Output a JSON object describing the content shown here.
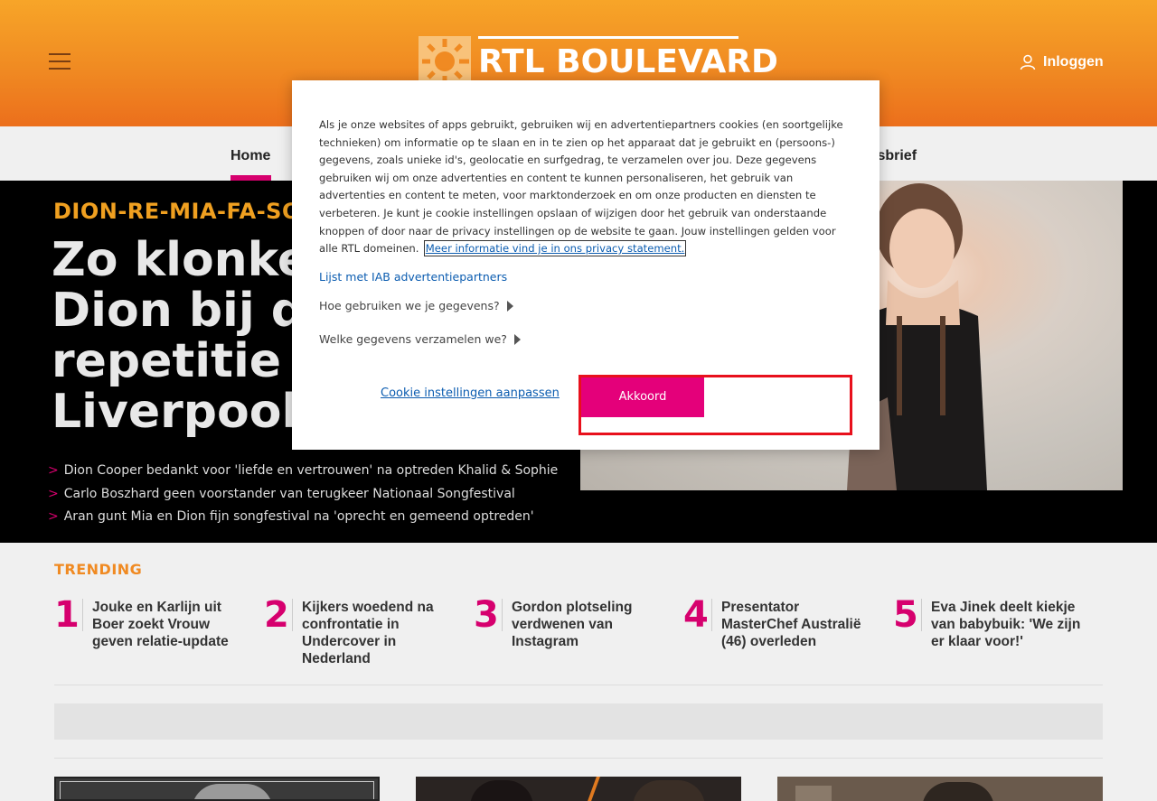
{
  "header": {
    "logo_text": "RTL BOULEVARD",
    "login_label": "Inloggen"
  },
  "nav": {
    "items": [
      {
        "label": "Home",
        "active": true
      },
      {
        "label": "Nieuwsbrief",
        "active": false
      }
    ],
    "partial_visible": "wsbrief"
  },
  "hero": {
    "kicker": "DION-RE-MIA-FA-SOL",
    "title": "Zo klonken Mia en Dion bij de eerste repetitie in Liverpool",
    "visible_title_lines": [
      "Zo klonke",
      "Dion bij de",
      "repetitie i",
      "Liverpool"
    ],
    "related": [
      "Dion Cooper bedankt voor 'liefde en vertrouwen' na optreden Khalid & Sophie",
      "Carlo Boszhard geen voorstander van terugkeer Nationaal Songfestival",
      "Aran gunt Mia en Dion fijn songfestival na 'oprecht en gemeend optreden'"
    ]
  },
  "trending": {
    "heading": "TRENDING",
    "items": [
      {
        "num": "1",
        "text": "Jouke en Karlijn uit Boer zoekt Vrouw geven relatie-update"
      },
      {
        "num": "2",
        "text": "Kijkers woedend na confrontatie in Undercover in Nederland"
      },
      {
        "num": "3",
        "text": "Gordon plotseling verdwenen van Instagram"
      },
      {
        "num": "4",
        "text": "Presentator MasterChef Australië (46) overleden"
      },
      {
        "num": "5",
        "text": "Eva Jinek deelt kiekje van babybuik: 'We zijn er klaar voor!'"
      }
    ]
  },
  "consent": {
    "body": "Als je onze websites of apps gebruikt, gebruiken wij en advertentiepartners cookies (en soortgelijke technieken) om informatie op te slaan en in te zien op het apparaat dat je gebruikt en (persoons-) gegevens, zoals unieke id's, geolocatie en surfgedrag, te verzamelen over jou. Deze gegevens gebruiken wij om onze advertenties en content te kunnen personaliseren, het gebruik van advertenties en content te meten, voor marktonderzoek en om onze producten en diensten te verbeteren. Je kunt je cookie instellingen opslaan of wijzigen door het gebruik van onderstaande knoppen of door naar de privacy instellingen op de website te gaan. Jouw instellingen gelden voor alle RTL domeinen.",
    "privacy_link": "Meer informatie vind je in ons privacy statement.",
    "iab_link": "Lijst met IAB advertentiepartners",
    "accordion_1": "Hoe gebruiken we je gegevens?",
    "accordion_2": "Welke gegevens verzamelen we?",
    "settings_link": "Cookie instellingen aanpassen",
    "accept_label": "Akkoord"
  },
  "colors": {
    "brand_orange": "#f08a22",
    "brand_magenta": "#d6006e",
    "accept_button": "#e4007a",
    "focus_outline": "#e8101c"
  }
}
